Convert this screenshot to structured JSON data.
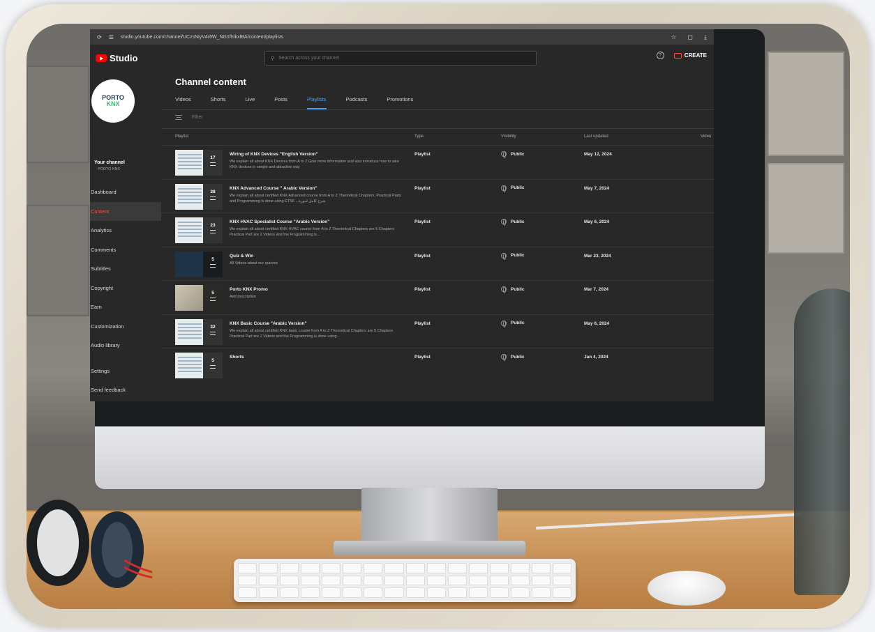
{
  "browser": {
    "url": "studio.youtube.com/channel/UCzsNiyV4r6W_NG1fhIkxlBA/content/playlists"
  },
  "header": {
    "logo_label": "Studio",
    "search_placeholder": "Search across your channel",
    "create_label": "CREATE",
    "help_glyph": "?"
  },
  "channel": {
    "logo_line1": "PORTO",
    "logo_line2": "KNX",
    "title": "Your channel",
    "name": "PORTO KNX"
  },
  "sidebar": {
    "items": [
      {
        "label": "Dashboard"
      },
      {
        "label": "Content"
      },
      {
        "label": "Analytics"
      },
      {
        "label": "Comments"
      },
      {
        "label": "Subtitles"
      },
      {
        "label": "Copyright"
      },
      {
        "label": "Earn"
      },
      {
        "label": "Customization"
      },
      {
        "label": "Audio library"
      },
      {
        "label": "Settings"
      },
      {
        "label": "Send feedback"
      }
    ],
    "active_index": 1
  },
  "main": {
    "title": "Channel content",
    "tabs": [
      "Videos",
      "Shorts",
      "Live",
      "Posts",
      "Playlists",
      "Podcasts",
      "Promotions"
    ],
    "active_tab": 4,
    "filter_label": "Filter",
    "columns": {
      "playlist": "Playlist",
      "type": "Type",
      "visibility": "Visibility",
      "last_updated": "Last updated",
      "video_count": "Video"
    },
    "rows": [
      {
        "count": "17",
        "title": "Wiring of KNX Devices \"English Version\"",
        "description": "We explain all about KNX Devices from A to Z Give more information and also introduce how to wire KNX devices in simple and attractive way",
        "type": "Playlist",
        "visibility": "Public",
        "updated": "May 12, 2024",
        "thumb": "slides"
      },
      {
        "count": "38",
        "title": "KNX Advanced Course \" Arabic Version\"",
        "description": "We explain all about certified KNX Advanced course from A to Z Theoretical Chapters, Practical Parts and Programming is done using ETS6 ...شرح كامل لدورة",
        "type": "Playlist",
        "visibility": "Public",
        "updated": "May 7, 2024",
        "thumb": "slides"
      },
      {
        "count": "23",
        "title": "KNX HVAC Specialist Course \"Arabic Version\"",
        "description": "We explain all about certified KNX HVAC course from A to Z Theoretical Chapters are 5 Chapters Practical Part are 2 Videos and the Programming is...",
        "type": "Playlist",
        "visibility": "Public",
        "updated": "May 6, 2024",
        "thumb": "slides"
      },
      {
        "count": "5",
        "title": "Quiz & Win",
        "description": "All Videos about our quizzes",
        "type": "Playlist",
        "visibility": "Public",
        "updated": "Mar 23, 2024",
        "thumb": "dark"
      },
      {
        "count": "5",
        "title": "Porto KNX Promo",
        "description": "Add description",
        "type": "Playlist",
        "visibility": "Public",
        "updated": "Mar 7, 2024",
        "thumb": "photo"
      },
      {
        "count": "32",
        "title": "KNX Basic Course \"Arabic Version\"",
        "description": "We explain all about certified KNX basic course from A to Z Theoretical Chapters are 5 Chapters Practical Part are 2 Videos and the Programming is done using...",
        "type": "Playlist",
        "visibility": "Public",
        "updated": "May 6, 2024",
        "thumb": "slides"
      },
      {
        "count": "5",
        "title": "Shorts",
        "description": "",
        "type": "Playlist",
        "visibility": "Public",
        "updated": "Jan 4, 2024",
        "thumb": "slides"
      }
    ]
  },
  "colors": {
    "accent_red": "#ff0000",
    "active_tab_blue": "#3ea6ff",
    "active_nav_red": "#ff4e45",
    "screen_bg": "#282828"
  }
}
